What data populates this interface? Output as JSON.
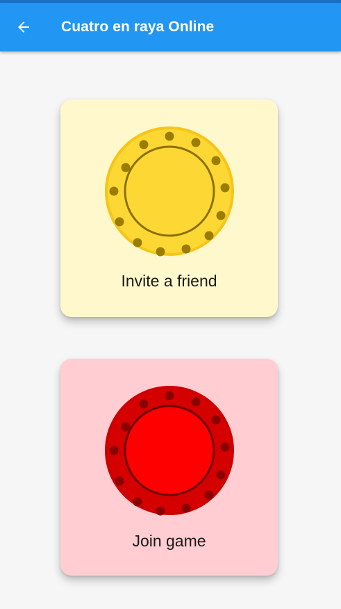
{
  "app_bar": {
    "title": "Cuatro en raya Online",
    "back_icon": "arrow-back-icon",
    "background": "#2196f3",
    "text_color": "#ffffff"
  },
  "options": [
    {
      "label": "Invite a friend",
      "card_color": "#fff8cc",
      "chip_color": "#fdd835",
      "chip_rim": "#f2c40f",
      "chip_dots": "#9a7d00",
      "icon": "yellow-chip-icon"
    },
    {
      "label": "Join game",
      "card_color": "#ffcdd2",
      "chip_color": "#ff0000",
      "chip_rim": "#d50000",
      "chip_dots": "#8a0000",
      "icon": "red-chip-icon"
    }
  ]
}
